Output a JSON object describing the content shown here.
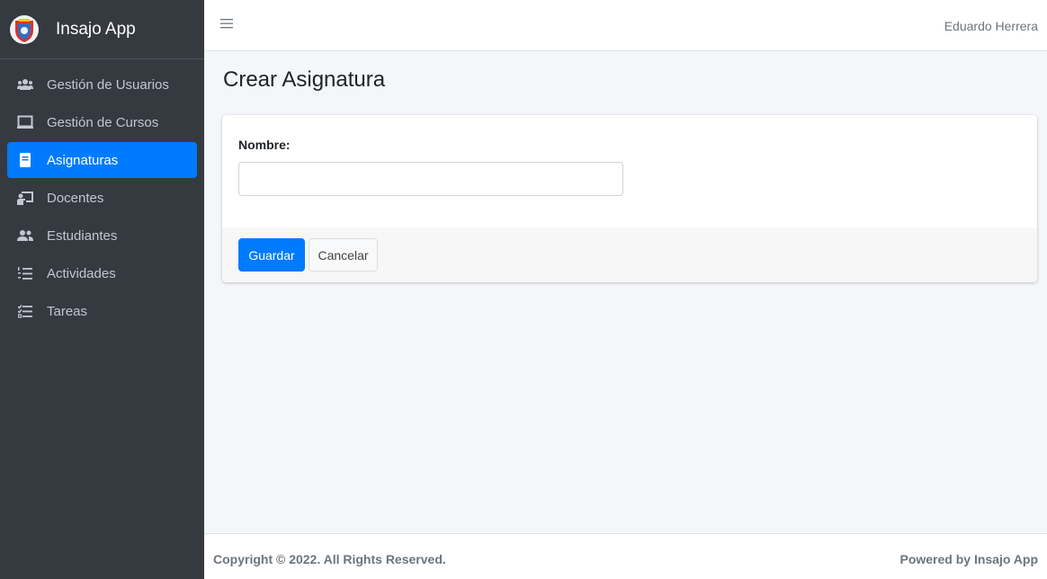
{
  "brand": {
    "name": "Insajo App",
    "logo_icon": "shield-logo"
  },
  "colors": {
    "sidebar": "#343a40",
    "accent": "#007bff",
    "background": "#f4f6f9"
  },
  "sidebar": {
    "items": [
      {
        "label": "Gestión de Usuarios",
        "icon": "users-icon",
        "active": false
      },
      {
        "label": "Gestión de Cursos",
        "icon": "monitor-icon",
        "active": false
      },
      {
        "label": "Asignaturas",
        "icon": "book-icon",
        "active": true
      },
      {
        "label": "Docentes",
        "icon": "chalkboard-teacher-icon",
        "active": false
      },
      {
        "label": "Estudiantes",
        "icon": "user-friends-icon",
        "active": false
      },
      {
        "label": "Actividades",
        "icon": "list-ol-icon",
        "active": false
      },
      {
        "label": "Tareas",
        "icon": "tasks-icon",
        "active": false
      }
    ]
  },
  "topbar": {
    "menu_icon": "hamburger-icon",
    "user_name": "Eduardo Herrera"
  },
  "page": {
    "title": "Crear Asignatura"
  },
  "form": {
    "name_label": "Nombre:",
    "name_value": "",
    "name_placeholder": "",
    "save_label": "Guardar",
    "cancel_label": "Cancelar"
  },
  "footer": {
    "copyright": "Copyright © 2022. All Rights Reserved.",
    "powered": "Powered by Insajo App"
  }
}
